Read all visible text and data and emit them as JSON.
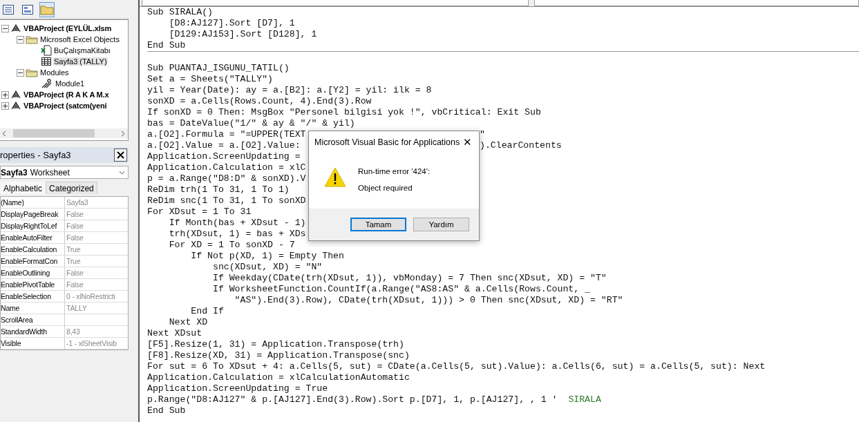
{
  "explorer": {
    "toolbar": [
      {
        "kind": "code",
        "pressed": false
      },
      {
        "kind": "object",
        "pressed": false
      },
      {
        "kind": "folders",
        "pressed": true
      }
    ],
    "tree": [
      {
        "label": "VBAProject (EYLÜL.xlsm",
        "kind": "project",
        "expanded": true,
        "selected": false,
        "children": [
          {
            "label": "Microsoft Excel Objects",
            "kind": "folder",
            "expanded": true,
            "selected": false,
            "children": [
              {
                "label": "BuÇalışmaKitabı",
                "kind": "workbook",
                "selected": false
              },
              {
                "label": "Sayfa3 (TALLY)",
                "kind": "sheet",
                "selected": true
              }
            ]
          },
          {
            "label": "Modules",
            "kind": "folder",
            "expanded": true,
            "selected": false,
            "children": [
              {
                "label": "Module1",
                "kind": "module",
                "selected": false
              }
            ]
          }
        ]
      },
      {
        "label": "VBAProject (R A K A M.x",
        "kind": "project",
        "expanded": false,
        "selected": false
      },
      {
        "label": "VBAProject (satcm(yeni",
        "kind": "project",
        "expanded": false,
        "selected": false
      }
    ]
  },
  "properties": {
    "title": "roperties - Sayfa3",
    "object": {
      "name": "Sayfa3",
      "type": "Worksheet"
    },
    "tabs": [
      {
        "label": "Alphabetic",
        "selected": true
      },
      {
        "label": "Categorized",
        "selected": false
      }
    ],
    "rows": [
      {
        "name": "(Name)",
        "value": "Sayfa3"
      },
      {
        "name": "DisplayPageBreak",
        "value": "False"
      },
      {
        "name": "DisplayRightToLef",
        "value": "False"
      },
      {
        "name": "EnableAutoFilter",
        "value": "False"
      },
      {
        "name": "EnableCalculation",
        "value": "True"
      },
      {
        "name": "EnableFormatCon",
        "value": "True"
      },
      {
        "name": "EnableOutlining",
        "value": "False"
      },
      {
        "name": "EnablePivotTable",
        "value": "False"
      },
      {
        "name": "EnableSelection",
        "value": "0 - xlNoRestricti"
      },
      {
        "name": "Name",
        "value": "TALLY"
      },
      {
        "name": "ScrollArea"
      },
      {
        "name": "StandardWidth",
        "value": "8,43"
      },
      {
        "name": "Visible",
        "value": "-1 - xlSheetVisib"
      }
    ]
  },
  "code": {
    "blocks": [
      {
        "lines": [
          {
            "text": "Sub SIRALA()"
          },
          {
            "text": "    [D8:AJ127].Sort [D7], 1"
          },
          {
            "text": "    [D129:AJ153].Sort [D128], 1"
          },
          {
            "text": "End Sub"
          }
        ]
      },
      {
        "lines": [
          {
            "text": "Sub PUANTAJ_ISGUNU_TATIL()"
          },
          {
            "text": "Set a = Sheets(\"TALLY\")"
          },
          {
            "text": "yil = Year(Date): ay = a.[B2]: a.[Y2] = yil: ilk = 8"
          },
          {
            "text": "sonXD = a.Cells(Rows.Count, 4).End(3).Row"
          },
          {
            "text": "If sonXD = 0 Then: MsgBox \"Personel bilgisi yok !\", vbCritical: Exit Sub"
          },
          {
            "text": "bas = DateValue(\"1/\" & ay & \"/\" & yil)"
          },
          {
            "text": "a.[O2].Formula = \"=UPPER(TEXT",
            "after": "\""
          },
          {
            "text": "a.[O2].Value = a.[O2].Value:",
            "after": ").ClearContents"
          },
          {
            "text": "Application.ScreenUpdating ="
          },
          {
            "text": "Application.Calculation = xlC"
          },
          {
            "text": "p = a.Range(\"D8:D\" & sonXD).V"
          },
          {
            "text": "ReDim trh(1 To 31, 1 To 1)"
          },
          {
            "text": "ReDim snc(1 To 31, 1 To sonXD"
          },
          {
            "text": "For XDsut = 1 To 31"
          },
          {
            "text": "    If Month(bas + XDsut - 1)"
          },
          {
            "text": "    trh(XDsut, 1) = bas + XDs"
          },
          {
            "text": "    For XD = 1 To sonXD - 7"
          },
          {
            "text": "        If Not p(XD, 1) = Empty Then"
          },
          {
            "text": "            snc(XDsut, XD) = \"N\""
          },
          {
            "text": "            If Weekday(CDate(trh(XDsut, 1)), vbMonday) = 7 Then snc(XDsut, XD) = \"T\""
          },
          {
            "text": "            If WorksheetFunction.CountIf(a.Range(\"AS8:AS\" & a.Cells(Rows.Count, _"
          },
          {
            "text": "                \"AS\").End(3).Row), CDate(trh(XDsut, 1))) > 0 Then snc(XDsut, XD) = \"RT\""
          },
          {
            "text": "        End If"
          },
          {
            "text": "    Next XD"
          },
          {
            "text": "Next XDsut"
          },
          {
            "text": "[F5].Resize(1, 31) = Application.Transpose(trh)"
          },
          {
            "text": "[F8].Resize(XD, 31) = Application.Transpose(snc)"
          },
          {
            "text": "For sut = 6 To XDsut + 4: a.Cells(5, sut) = CDate(a.Cells(5, sut).Value): a.Cells(6, sut) = a.Cells(5, sut): Next"
          },
          {
            "text": "Application.Calculation = xlCalculationAutomatic"
          },
          {
            "text": "Application.ScreenUpdating = True"
          },
          {
            "text": "p.Range(\"D8:AJ127\" & p.[AJ127].End(3).Row).Sort p.[D7], 1, p.[AJ127], , 1 '  ",
            "comment": "SIRALA"
          },
          {
            "text": "End Sub"
          }
        ]
      }
    ]
  },
  "dialog": {
    "title": "Microsoft Visual Basic for Applications",
    "close": "✕",
    "message": [
      "Run-time error '424':",
      "Object required"
    ],
    "buttons": [
      {
        "label": "Tamam",
        "default": true
      },
      {
        "label": "Yardım",
        "default": false
      }
    ]
  }
}
